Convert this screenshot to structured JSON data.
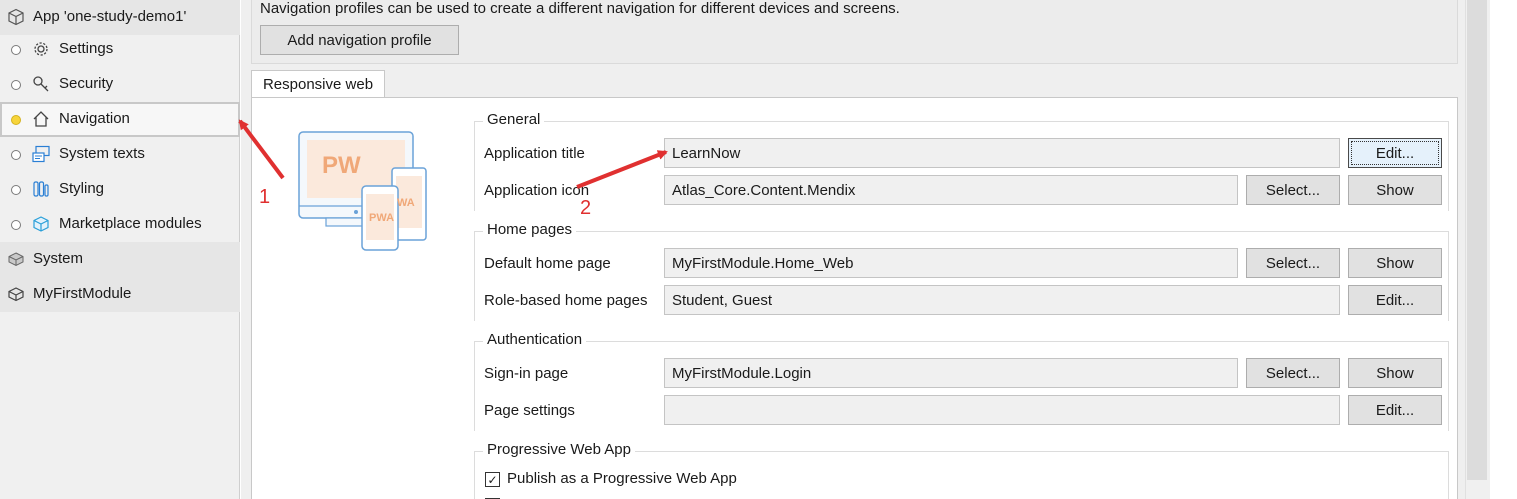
{
  "sidebar": {
    "app": "App 'one-study-demo1'",
    "items": [
      {
        "label": "Settings",
        "icon": "gear-icon"
      },
      {
        "label": "Security",
        "icon": "key-icon"
      },
      {
        "label": "Navigation",
        "icon": "home-icon"
      },
      {
        "label": "System texts",
        "icon": "text-icon"
      },
      {
        "label": "Styling",
        "icon": "styling-icon"
      },
      {
        "label": "Marketplace modules",
        "icon": "box-icon"
      }
    ],
    "modules": [
      {
        "label": "System"
      },
      {
        "label": "MyFirstModule"
      }
    ]
  },
  "main": {
    "info_text": "Navigation profiles can be used to create a different navigation for different devices and screens.",
    "add_profile_button": "Add navigation profile",
    "tab": "Responsive web",
    "illustration_text": "PWA",
    "groups": {
      "general": {
        "title": "General",
        "application_title_label": "Application title",
        "application_title_value": "LearnNow",
        "edit_button": "Edit...",
        "application_icon_label": "Application icon",
        "application_icon_value": "Atlas_Core.Content.Mendix",
        "select_button": "Select...",
        "show_button": "Show"
      },
      "home_pages": {
        "title": "Home pages",
        "default_home_page_label": "Default home page",
        "default_home_page_value": "MyFirstModule.Home_Web",
        "select_button": "Select...",
        "show_button": "Show",
        "role_based_label": "Role-based home pages",
        "role_based_value": "Student, Guest",
        "edit_button": "Edit..."
      },
      "authentication": {
        "title": "Authentication",
        "sign_in_label": "Sign-in page",
        "sign_in_value": "MyFirstModule.Login",
        "select_button": "Select...",
        "show_button": "Show",
        "page_settings_label": "Page settings",
        "page_settings_value": "",
        "edit_button": "Edit..."
      },
      "pwa": {
        "title": "Progressive Web App",
        "publish_label": "Publish as a Progressive Web App",
        "publish_checked": true
      }
    }
  },
  "annotations": {
    "marker_1": "1",
    "marker_2": "2",
    "color": "#e03030"
  }
}
